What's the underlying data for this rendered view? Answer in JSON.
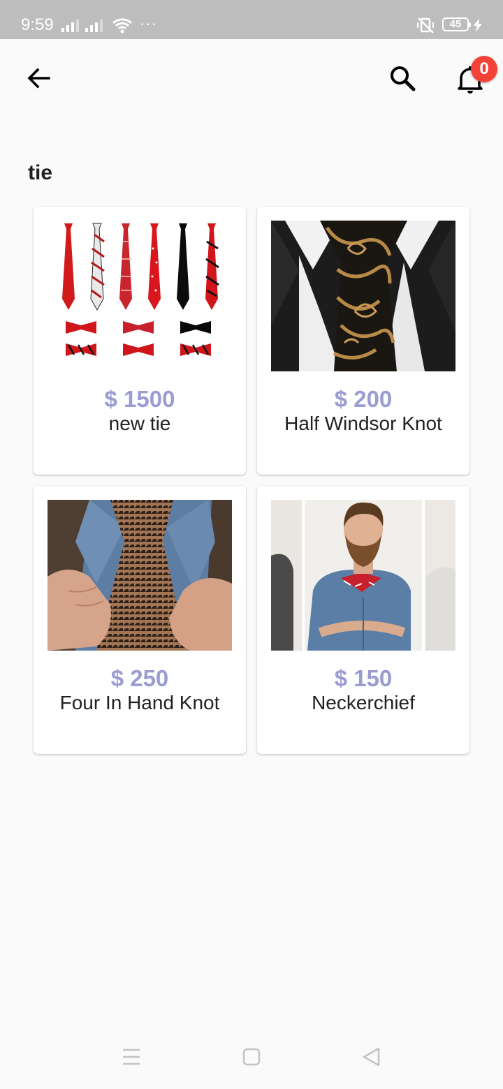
{
  "status_bar": {
    "time": "9:59",
    "battery": "45",
    "more": "···",
    "icons": [
      "signal-icon",
      "signal-icon",
      "wifi-icon",
      "vibrate-off-icon",
      "battery-icon",
      "charging-bolt-icon"
    ]
  },
  "app_bar": {
    "icons": [
      "back-arrow-icon",
      "search-icon",
      "bell-icon"
    ],
    "notification_count": "0"
  },
  "page": {
    "title": "tie"
  },
  "products": [
    {
      "price": "$ 1500",
      "name": "new tie"
    },
    {
      "price": "$ 200",
      "name": "Half Windsor Knot"
    },
    {
      "price": "$ 250",
      "name": "Four In Hand Knot"
    },
    {
      "price": "$ 150",
      "name": "Neckerchief"
    }
  ],
  "nav_bar": {
    "icons": [
      "menu-icon",
      "home-square-icon",
      "back-triangle-icon"
    ]
  },
  "colors": {
    "price": "#9a9cd2",
    "badge": "#f44336",
    "status_bar": "#bdbdbd",
    "background": "#fafafa"
  }
}
